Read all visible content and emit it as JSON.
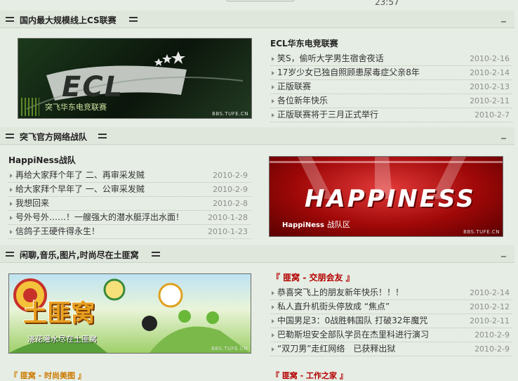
{
  "top": {
    "clock": "23:57"
  },
  "sections": [
    {
      "title": "国内最大规模线上CS联赛",
      "banner": {
        "caption": "突飞华东电竞联赛",
        "logo_text": "ECL",
        "watermark": "BBS.TUFE.CN"
      },
      "list_title": "ECL华东电竞联赛",
      "items": [
        {
          "text": "笑S，偷听大学男生宿舍夜话",
          "date": "2010-2-16"
        },
        {
          "text": "17岁少女已独自照顾患尿毒症父亲8年",
          "date": "2010-2-14"
        },
        {
          "text": "正版联赛",
          "date": "2010-2-13"
        },
        {
          "text": "各位新年快乐",
          "date": "2010-2-11"
        },
        {
          "text": "正版联赛将于三月正式举行",
          "date": "2010-2-7"
        }
      ]
    },
    {
      "title": "突飞官方网络战队",
      "banner": {
        "caption": "战队区",
        "caption_prefix": "HappiNess",
        "logo_text": "HAPPINESS",
        "watermark": "BBS.TUFE.CN"
      },
      "list_title": "HappiNess战队",
      "items": [
        {
          "text": "再给大家拜个年了 二、再审采发贼",
          "date": "2010-2-9"
        },
        {
          "text": "给大家拜个早年了 一、公审采发贼",
          "date": "2010-2-9"
        },
        {
          "text": "我想回来",
          "date": "2010-2-8"
        },
        {
          "text": "号外号外……！一艘强大的潜水艇浮出水面！",
          "date": "2010-1-28"
        },
        {
          "text": "信鸽子王硬件得永生！",
          "date": "2010-1-23"
        }
      ]
    },
    {
      "title": "闲聊,音乐,图片,时尚尽在土匪窝",
      "banner": {
        "caption": "浇花灌水尽在土匪窝",
        "logo_text": "土匪窝",
        "watermark": "BBS.TUFE.CN"
      },
      "list_title": "『 匪窝 - 交朋会友 』",
      "items": [
        {
          "text": "恭喜突飞上的朋友新年快乐！！！",
          "date": "2010-2-14"
        },
        {
          "text": "私人直升机街头停放成 “焦点”",
          "date": "2010-2-12"
        },
        {
          "text": "中国男足3：0战胜韩国队 打破32年魔咒",
          "date": "2010-2-11"
        },
        {
          "text": "巴勒斯坦安全部队学员在杰里科进行演习",
          "date": "2010-2-9"
        },
        {
          "text": "“双刀男”走红网络　已获释出狱",
          "date": "2010-2-9"
        }
      ]
    }
  ],
  "bottom": {
    "left": "『 匪窝 - 时尚美图 』",
    "right": "『 匪窝 - 工作之家 』"
  },
  "colors": {
    "accent_red": "#b40000",
    "section_bg": "#dfe7dc",
    "page_bg": "#e6ede4"
  }
}
